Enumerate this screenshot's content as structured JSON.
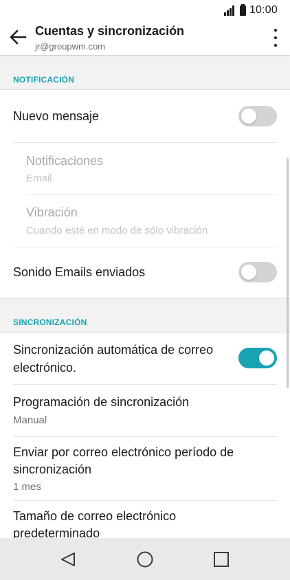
{
  "status_bar": {
    "time": "10:00",
    "signal_icon": "signal-icon",
    "battery_icon": "battery-icon"
  },
  "app_bar": {
    "title": "Cuentas y sincronización",
    "subtitle": "jr@groupwm.com",
    "back_icon": "arrow-back-icon",
    "menu_icon": "more-vertical-icon"
  },
  "sections": {
    "notification": {
      "header": "NOTIFICACIÓN",
      "new_message": {
        "label": "Nuevo mensaje",
        "enabled": false
      },
      "notifications": {
        "label": "Notificaciones",
        "value": "Email"
      },
      "vibration": {
        "label": "Vibración",
        "value": "Cuando esté en modo de sólo vibración"
      },
      "sent_sound": {
        "label": "Sonido Emails enviados",
        "enabled": false
      }
    },
    "sync": {
      "header": "SINCRONIZACIÓN",
      "auto_sync": {
        "label_line1": "Sincronización automática de correo",
        "label_line2": "electrónico.",
        "enabled": true
      },
      "schedule": {
        "label": "Programación de sincronización",
        "value": "Manual"
      },
      "period": {
        "label_line1": "Enviar por correo electrónico período de",
        "label_line2": "sincronización",
        "value": "1 mes"
      },
      "size": {
        "label_line1": "Tamaño de correo electrónico",
        "label_line2": "predeterminado"
      }
    }
  },
  "colors": {
    "accent": "#1aa3b3",
    "toggle_off": "#d4d4d4",
    "section_bg": "#f2f2f2",
    "nav_bg": "#e9e9ec"
  },
  "nav_bar": {
    "back_icon": "nav-back-triangle-icon",
    "home_icon": "nav-home-circle-icon",
    "recents_icon": "nav-recents-square-icon"
  }
}
